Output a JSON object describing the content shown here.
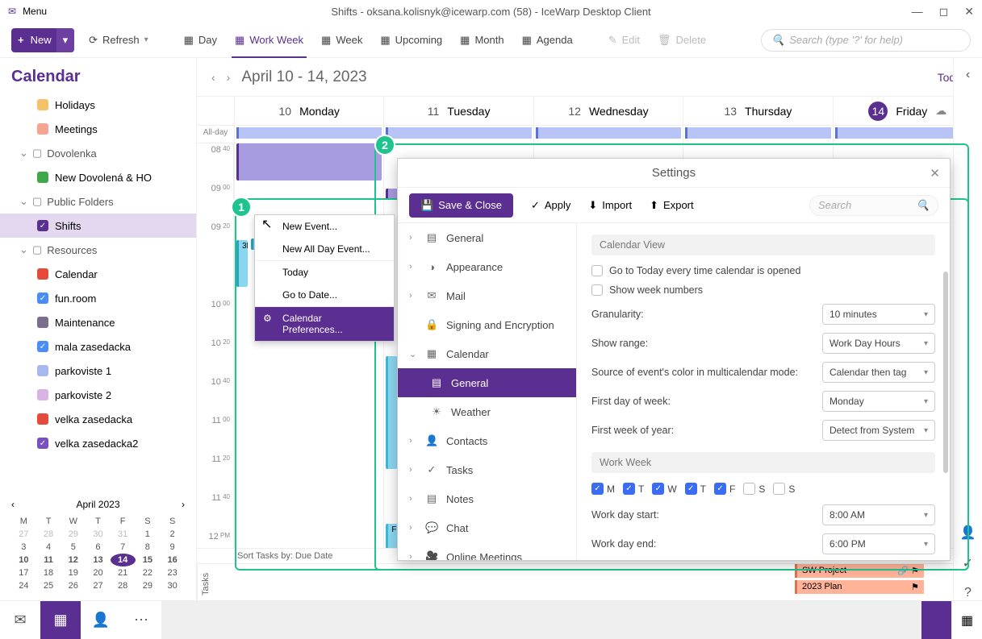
{
  "titlebar": {
    "menu": "Menu",
    "title": "Shifts - oksana.kolisnyk@icewarp.com (58) - IceWarp Desktop Client"
  },
  "toolbar": {
    "new": "New",
    "refresh": "Refresh",
    "day": "Day",
    "work_week": "Work Week",
    "week": "Week",
    "upcoming": "Upcoming",
    "month": "Month",
    "agenda": "Agenda",
    "edit": "Edit",
    "delete": "Delete",
    "search_placeholder": "Search (type '?' for help)"
  },
  "sidebar": {
    "title": "Calendar",
    "items": {
      "holidays": "Holidays",
      "meetings": "Meetings",
      "dovolenka": "Dovolenka",
      "new_dov": "New Dovolená & HO",
      "public": "Public Folders",
      "shifts": "Shifts",
      "resources": "Resources",
      "calendar": "Calendar",
      "funroom": "fun.room",
      "maintenance": "Maintenance",
      "mala": "mala zasedacka",
      "park1": "parkoviste 1",
      "park2": "parkoviste 2",
      "velka": "velka zasedacka",
      "velka2": "velka zasedacka2"
    }
  },
  "minical": {
    "title": "April 2023",
    "dow": [
      "M",
      "T",
      "W",
      "T",
      "F",
      "S",
      "S"
    ],
    "prev": [
      "27",
      "28",
      "29",
      "30",
      "31",
      "1",
      "2"
    ],
    "rows": [
      [
        "3",
        "4",
        "5",
        "6",
        "7",
        "8",
        "9"
      ],
      [
        "10",
        "11",
        "12",
        "13",
        "14",
        "15",
        "16"
      ],
      [
        "17",
        "18",
        "19",
        "20",
        "21",
        "22",
        "23"
      ],
      [
        "24",
        "25",
        "26",
        "27",
        "28",
        "29",
        "30"
      ]
    ]
  },
  "cal": {
    "range": "April 10 - 14, 2023",
    "today": "Today",
    "allday": "All-day",
    "days": [
      {
        "num": "10",
        "name": "Monday"
      },
      {
        "num": "11",
        "name": "Tuesday"
      },
      {
        "num": "12",
        "name": "Wednesday"
      },
      {
        "num": "13",
        "name": "Thursday"
      },
      {
        "num": "14",
        "name": "Friday"
      }
    ],
    "times": [
      "08 40",
      "09 00",
      "09 20",
      "",
      "10 00",
      "10 20",
      "10 40",
      "11 00",
      "11 20",
      "11 40",
      "12 PM"
    ],
    "sort_tasks": "Sort Tasks by: Due Date",
    "tasks_label": "Tasks",
    "task1": "SW Project",
    "task2": "2023 Plan"
  },
  "ctx": {
    "new_event": "New Event...",
    "new_allday": "New All Day Event...",
    "today": "Today",
    "goto": "Go to Date...",
    "prefs": "Calendar Preferences..."
  },
  "settings": {
    "title": "Settings",
    "save": "Save & Close",
    "apply": "Apply",
    "import": "Import",
    "export": "Export",
    "search": "Search",
    "nav": {
      "general": "General",
      "appearance": "Appearance",
      "mail": "Mail",
      "signing": "Signing and Encryption",
      "calendar": "Calendar",
      "cal_general": "General",
      "weather": "Weather",
      "contacts": "Contacts",
      "tasks": "Tasks",
      "notes": "Notes",
      "chat": "Chat",
      "online": "Online Meetings"
    },
    "content": {
      "sec_view": "Calendar View",
      "goto_today": "Go to Today every time calendar is opened",
      "show_week": "Show week numbers",
      "granularity": "Granularity:",
      "granularity_v": "10 minutes",
      "show_range": "Show range:",
      "show_range_v": "Work Day Hours",
      "color_src": "Source of event's color in multicalendar mode:",
      "color_src_v": "Calendar then tag",
      "first_dow": "First day of week:",
      "first_dow_v": "Monday",
      "first_woy": "First week of year:",
      "first_woy_v": "Detect from System",
      "sec_ww": "Work Week",
      "days": [
        "M",
        "T",
        "W",
        "T",
        "F",
        "S",
        "S"
      ],
      "days_on": [
        true,
        true,
        true,
        true,
        true,
        false,
        false
      ],
      "wd_start": "Work day start:",
      "wd_start_v": "8:00 AM",
      "wd_end": "Work day end:",
      "wd_end_v": "6:00 PM"
    }
  },
  "markers": {
    "m1": "1",
    "m2": "2"
  }
}
